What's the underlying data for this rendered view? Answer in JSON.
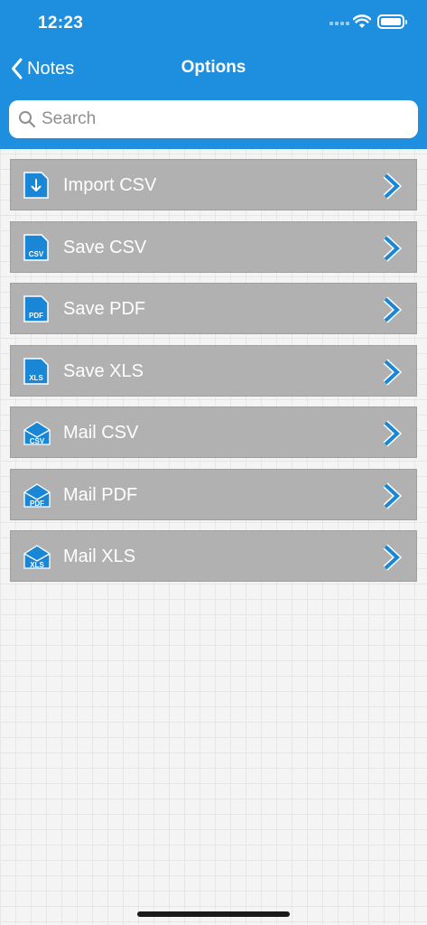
{
  "status_bar": {
    "time": "12:23"
  },
  "nav": {
    "back_label": "Notes",
    "title": "Options"
  },
  "search": {
    "placeholder": "Search"
  },
  "options": [
    {
      "label": "Import CSV",
      "icon": "import-file-icon",
      "badge": ""
    },
    {
      "label": "Save CSV",
      "icon": "save-csv-icon",
      "badge": "CSV"
    },
    {
      "label": "Save PDF",
      "icon": "save-pdf-icon",
      "badge": "PDF"
    },
    {
      "label": "Save XLS",
      "icon": "save-xls-icon",
      "badge": "XLS"
    },
    {
      "label": "Mail CSV",
      "icon": "mail-csv-icon",
      "badge": "CSV"
    },
    {
      "label": "Mail PDF",
      "icon": "mail-pdf-icon",
      "badge": "PDF"
    },
    {
      "label": "Mail XLS",
      "icon": "mail-xls-icon",
      "badge": "XLS"
    }
  ],
  "colors": {
    "accent": "#1e8ede",
    "row_background": "#b1b1b1",
    "icon_blue": "#1a86d6"
  }
}
